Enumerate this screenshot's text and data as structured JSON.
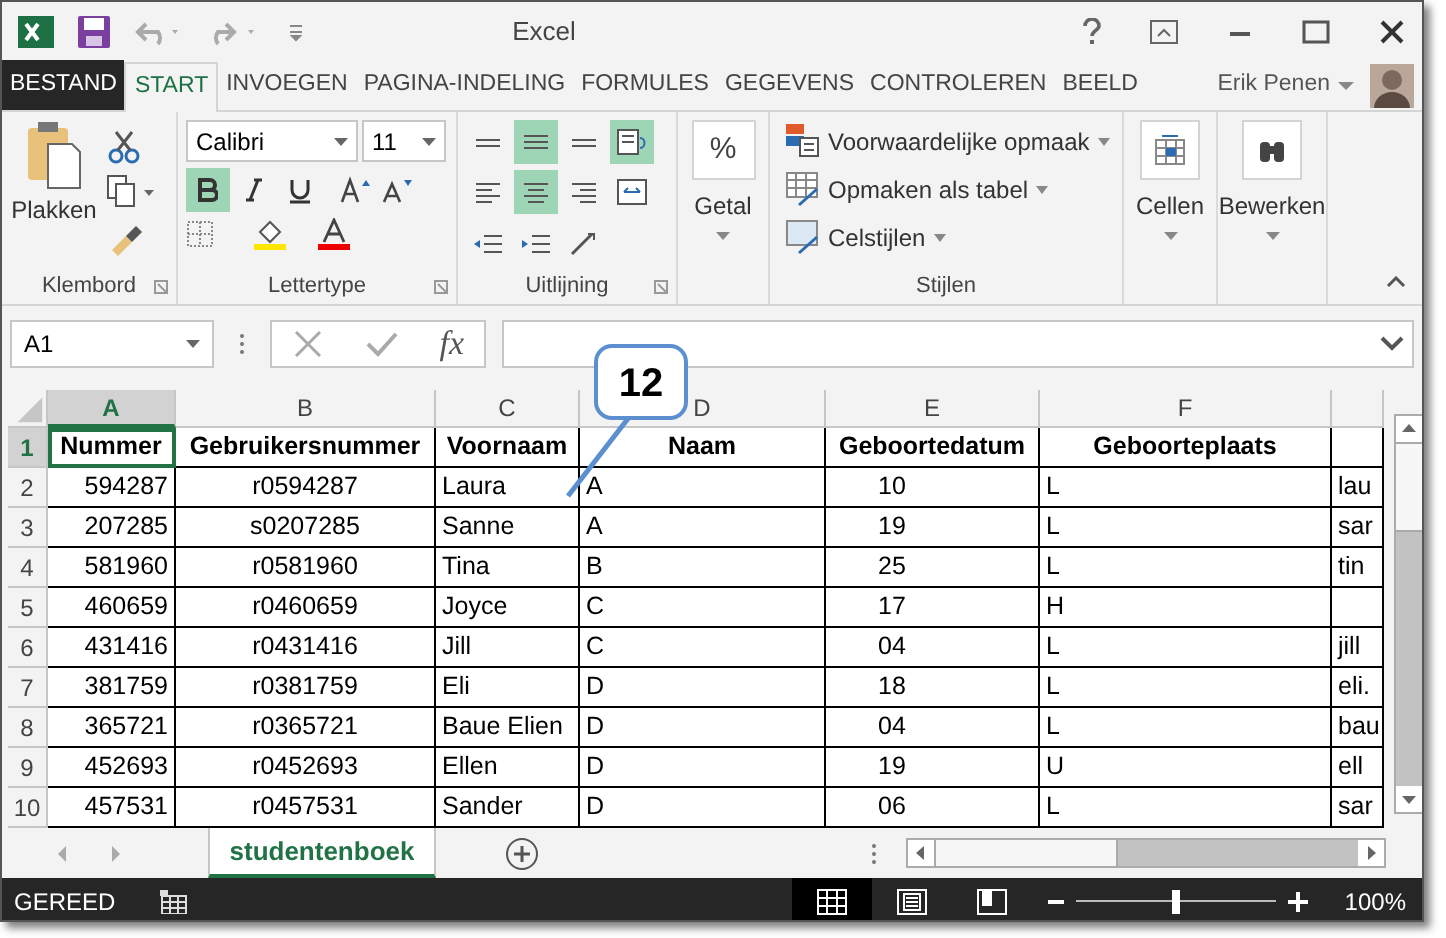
{
  "window": {
    "title": "Excel"
  },
  "tabs": [
    {
      "label": "BESTAND",
      "kind": "file",
      "selected": false
    },
    {
      "label": "START",
      "kind": "tab",
      "selected": true
    },
    {
      "label": "INVOEGEN",
      "kind": "tab",
      "selected": false
    },
    {
      "label": "PAGINA-INDELING",
      "kind": "tab",
      "selected": false
    },
    {
      "label": "FORMULES",
      "kind": "tab",
      "selected": false
    },
    {
      "label": "GEGEVENS",
      "kind": "tab",
      "selected": false
    },
    {
      "label": "CONTROLEREN",
      "kind": "tab",
      "selected": false
    },
    {
      "label": "BEELD",
      "kind": "tab",
      "selected": false
    }
  ],
  "user": {
    "name": "Erik Penen"
  },
  "ribbon": {
    "clipboard": {
      "paste": "Plakken",
      "label": "Klembord"
    },
    "font": {
      "name": "Calibri",
      "size": "11",
      "bold": true,
      "label": "Lettertype"
    },
    "alignment": {
      "center": true,
      "wrap_text": true,
      "label": "Uitlijning"
    },
    "number": {
      "symbol": "%",
      "button": "Getal"
    },
    "styles": {
      "items": [
        "Voorwaardelijke opmaak",
        "Opmaken als tabel",
        "Celstijlen"
      ],
      "label": "Stijlen"
    },
    "cells": {
      "button": "Cellen"
    },
    "editing": {
      "button": "Bewerken"
    }
  },
  "formula_bar": {
    "name_box": "A1",
    "function_label": "fx"
  },
  "sheet": {
    "columns": [
      {
        "label": "A",
        "selected": true
      },
      {
        "label": "B",
        "selected": false
      },
      {
        "label": "C",
        "selected": false
      },
      {
        "label": "D",
        "selected": false
      },
      {
        "label": "E",
        "selected": false
      },
      {
        "label": "F",
        "selected": false
      },
      {
        "selected": false
      }
    ],
    "rows": [
      {
        "number": "1",
        "selected": true,
        "cells": [
          "Nummer",
          "Gebruikersnummer",
          "Voornaam",
          "Naam",
          "Geboortedatum",
          "Geboorteplaats",
          ""
        ]
      },
      {
        "number": "2",
        "selected": false,
        "cells": [
          "594287",
          "r0594287",
          "Laura",
          "A",
          "10",
          "L",
          "lau"
        ]
      },
      {
        "number": "3",
        "selected": false,
        "cells": [
          "207285",
          "s0207285",
          "Sanne",
          "A",
          "19",
          "L",
          "sar"
        ]
      },
      {
        "number": "4",
        "selected": false,
        "cells": [
          "581960",
          "r0581960",
          "Tina",
          "B",
          "25",
          "L",
          "tin"
        ]
      },
      {
        "number": "5",
        "selected": false,
        "cells": [
          "460659",
          "r0460659",
          "Joyce",
          "C",
          "17",
          "H",
          ""
        ]
      },
      {
        "number": "6",
        "selected": false,
        "cells": [
          "431416",
          "r0431416",
          "Jill",
          "C",
          "04",
          "L",
          "jill"
        ]
      },
      {
        "number": "7",
        "selected": false,
        "cells": [
          "381759",
          "r0381759",
          "Eli",
          "D",
          "18",
          "L",
          "eli."
        ]
      },
      {
        "number": "8",
        "selected": false,
        "cells": [
          "365721",
          "r0365721",
          "Baue Elien",
          "D",
          "04",
          "L",
          "bau"
        ]
      },
      {
        "number": "9",
        "selected": false,
        "cells": [
          "452693",
          "r0452693",
          "Ellen",
          "D",
          "19",
          "U",
          "ell"
        ]
      },
      {
        "number": "10",
        "selected": false,
        "cells": [
          "457531",
          "r0457531",
          "Sander",
          "D",
          "06",
          "L",
          "sar"
        ]
      }
    ]
  },
  "callout": {
    "label": "12"
  },
  "sheet_tabs": [
    {
      "label": "studentenboek",
      "selected": true
    }
  ],
  "status_bar": {
    "text": "GEREED",
    "views": [
      {
        "kind": "normal",
        "selected": true
      },
      {
        "kind": "page_layout",
        "selected": false
      },
      {
        "kind": "page_break",
        "selected": false
      }
    ],
    "zoom": {
      "level": 0.5,
      "reading": "100%"
    }
  }
}
